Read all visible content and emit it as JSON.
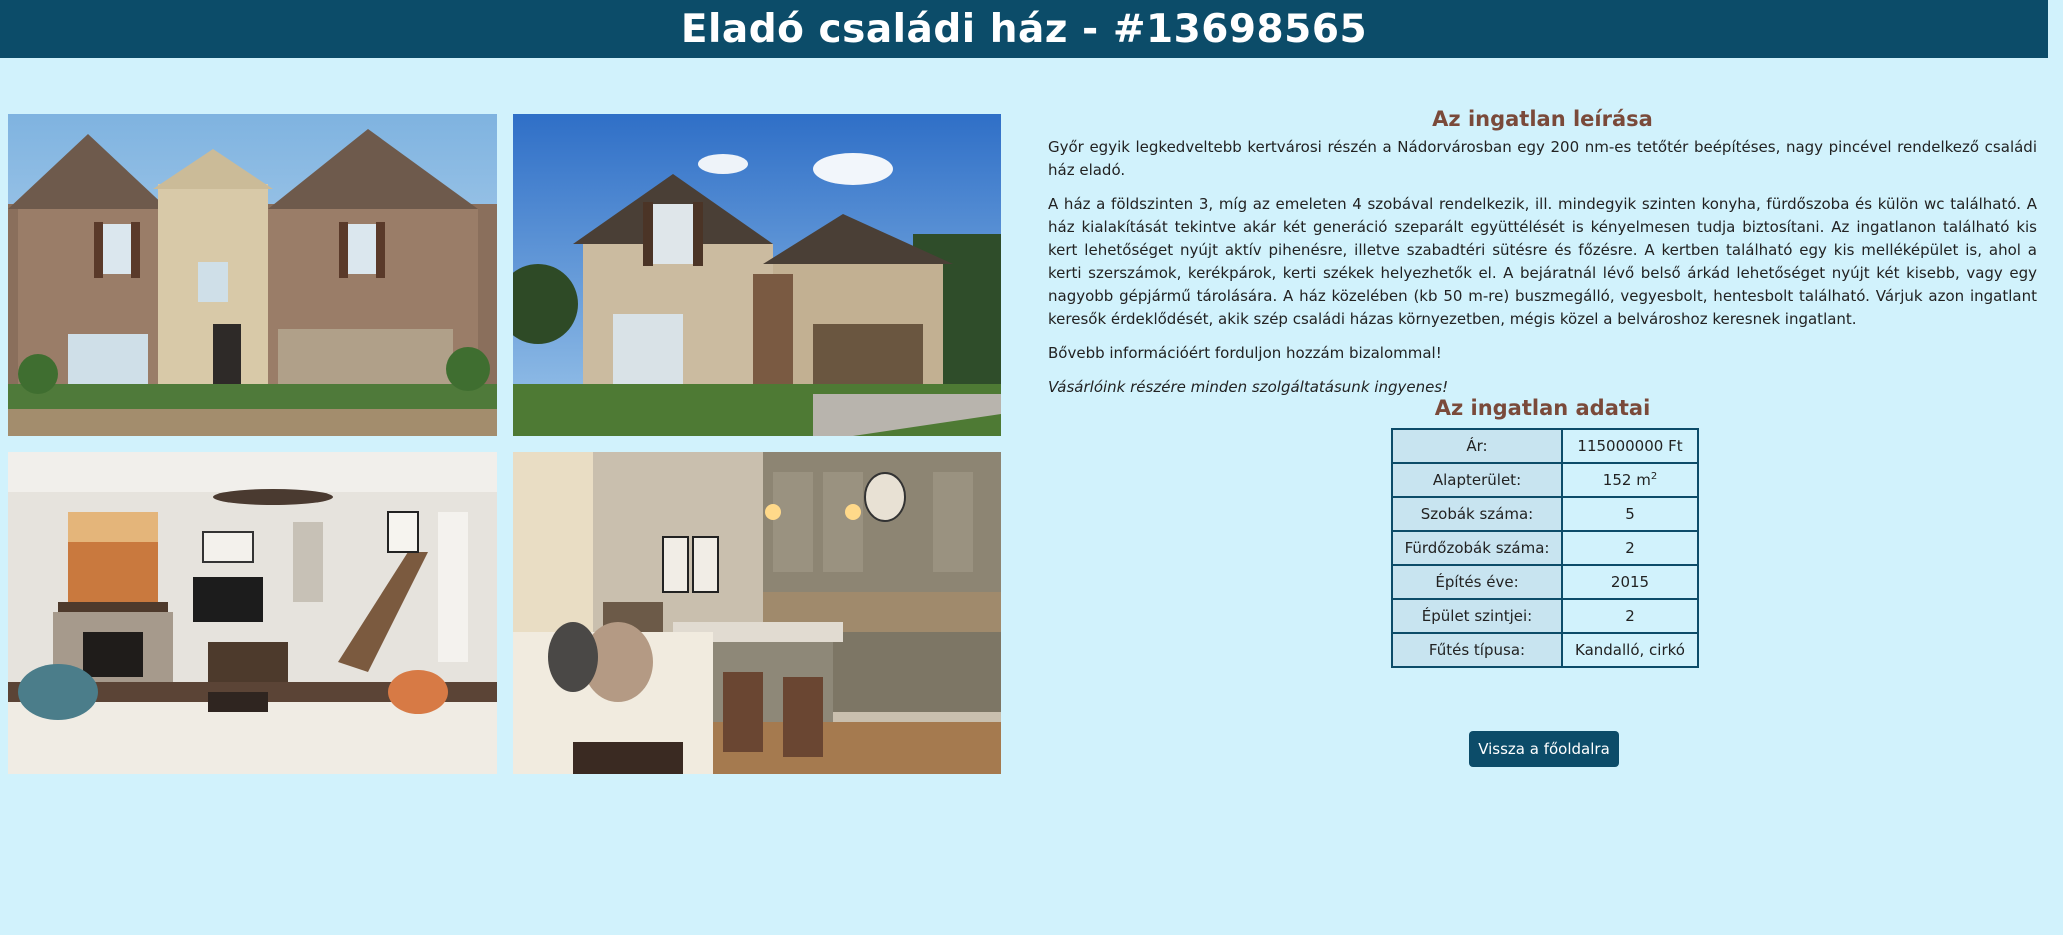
{
  "header": {
    "title": "Eladó családi ház - #13698565"
  },
  "description": {
    "heading": "Az ingatlan leírása",
    "paragraphs": [
      "Győr egyik legkedveltebb kertvárosi részén a Nádorvárosban egy 200 nm-es tetőtér beépítéses, nagy pincével rendelkező családi ház eladó.",
      "A ház a földszinten 3, míg az emeleten 4 szobával rendelkezik, ill. mindegyik szinten konyha, fürdőszoba és külön wc található. A ház kialakítását tekintve akár két generáció szeparált együttélését is kényelmesen tudja biztosítani. Az ingatlanon található kis kert lehetőséget nyújt aktív pihenésre, illetve szabadtéri sütésre és főzésre. A kertben található egy kis melléképület is, ahol a kerti szerszámok, kerékpárok, kerti székek helyezhetők el. A bejáratnál lévő belső árkád lehetőséget nyújt két kisebb, vagy egy nagyobb gépjármű tárolására. A ház közelében (kb 50 m-re) buszmegálló, vegyesbolt, hentesbolt található. Várjuk azon ingatlant keresők érdeklődését, akik szép családi házas környezetben, mégis közel a belvároshoz keresnek ingatlant.",
      "Bővebb információért forduljon hozzám bizalommal!"
    ],
    "italic_note": "Vásárlóink részére minden szolgáltatásunk ingyenes!"
  },
  "property_data": {
    "heading": "Az ingatlan adatai",
    "rows": [
      {
        "label": "Ár:",
        "value": "115000000 Ft"
      },
      {
        "label": "Alapterület:",
        "value": "152 m",
        "sup": "2"
      },
      {
        "label": "Szobák száma:",
        "value": "5"
      },
      {
        "label": "Fürdőzobák száma:",
        "value": "2"
      },
      {
        "label": "Építés éve:",
        "value": "2015"
      },
      {
        "label": "Épület szintjei:",
        "value": "2"
      },
      {
        "label": "Fűtés típusa:",
        "value": "Kandalló, cirkó"
      }
    ]
  },
  "actions": {
    "back_label": "Vissza a főoldalra"
  },
  "colors": {
    "header_bg": "#0c4c69",
    "page_bg": "#d1f2fc",
    "heading": "#7a4a3a",
    "button_bg": "#0c4c69"
  }
}
